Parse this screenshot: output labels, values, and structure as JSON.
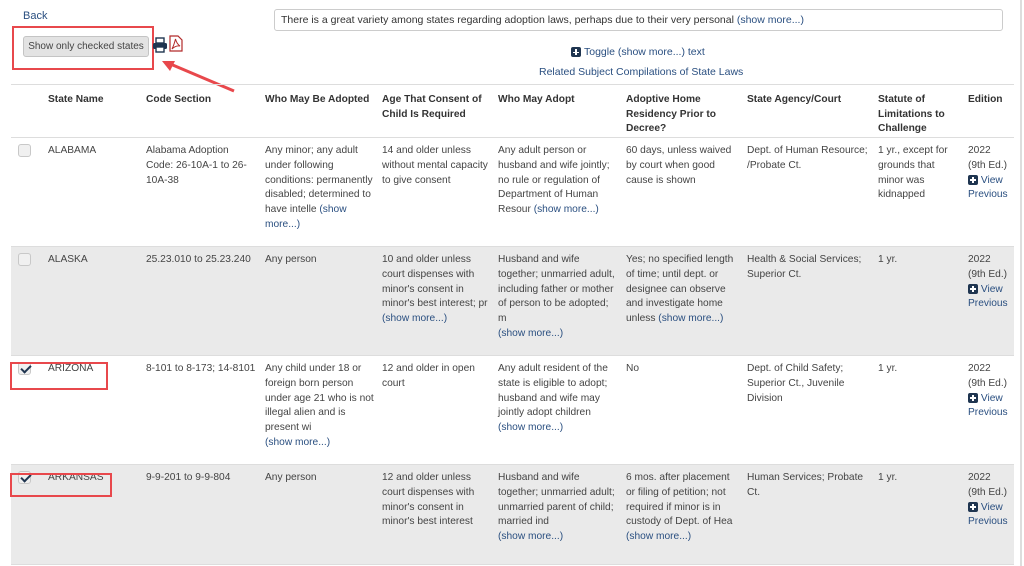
{
  "nav": {
    "back_label": "Back"
  },
  "toolbar": {
    "show_checked_label": "Show only checked states",
    "print_icon": "print-icon",
    "pdf_icon": "pdf-icon"
  },
  "intro": {
    "text": "There is a great variety among states regarding adoption laws, perhaps due to their very personal",
    "show_more": "(show more...)"
  },
  "toggle_label": "Toggle (show more...) text",
  "related_label": "Related Subject Compilations of State Laws",
  "colors": {
    "accent": "#2a4f80",
    "callout": "#e8484c",
    "row_shade": "#eaeaea"
  },
  "table": {
    "headers": [
      "",
      "State Name",
      "Code Section",
      "Who May Be Adopted",
      "Age That Consent of Child Is Required",
      "Who May Adopt",
      "Adoptive Home Residency Prior to Decree?",
      "State Agency/Court",
      "Statute of Limitations to Challenge",
      "Edition"
    ],
    "show_more": "(show more...)",
    "rows": [
      {
        "checked": false,
        "state": "ALABAMA",
        "code": "Alabama Adoption Code: 26-10A-1 to 26-10A-38",
        "who_adopted": "Any minor; any adult under following conditions: permanently disabled; determined to have intelle",
        "who_adopted_more": true,
        "age_consent": "14 and older unless without mental capacity to give consent",
        "age_consent_more": false,
        "who_adopt": "Any adult person or husband and wife jointly; no rule or regulation of Department of Human Resour",
        "who_adopt_more": true,
        "residency": "60 days, unless waived by court when good cause is shown",
        "residency_more": false,
        "agency": "Dept. of Human Resource; /Probate Ct.",
        "limitations": "1 yr., except for grounds that minor was kidnapped",
        "edition": "2022 (9th Ed.)",
        "view_previous": "View Previous"
      },
      {
        "checked": false,
        "state": "ALASKA",
        "code": "25.23.010 to 25.23.240",
        "who_adopted": "Any person",
        "who_adopted_more": false,
        "age_consent": "10 and older unless court dispenses with minor's consent in minor's best interest; pr",
        "age_consent_more": true,
        "who_adopt": "Husband and wife together; unmarried adult, including father or mother of person to be adopted; m",
        "who_adopt_more": true,
        "residency": "Yes; no specified length of time; until dept. or designee can observe and investigate home unless",
        "residency_more": true,
        "agency": "Health & Social Services; Superior Ct.",
        "limitations": "1 yr.",
        "edition": "2022 (9th Ed.)",
        "view_previous": "View Previous"
      },
      {
        "checked": true,
        "state": "ARIZONA",
        "code": "8-101 to 8-173; 14-8101",
        "who_adopted": "Any child under 18 or foreign born person under age 21 who is not illegal alien and is present wi",
        "who_adopted_more": true,
        "age_consent": "12 and older in open court",
        "age_consent_more": false,
        "who_adopt": "Any adult resident of the state is eligible to adopt; husband and wife may jointly adopt children",
        "who_adopt_more": true,
        "residency": "No",
        "residency_more": false,
        "agency": "Dept. of Child Safety; Superior Ct., Juvenile Division",
        "limitations": "1 yr.",
        "edition": "2022 (9th Ed.)",
        "view_previous": "View Previous"
      },
      {
        "checked": true,
        "state": "ARKANSAS",
        "code": "9-9-201 to 9-9-804",
        "who_adopted": "Any person",
        "who_adopted_more": false,
        "age_consent": "12 and older unless court dispenses with minor's consent in minor's best interest",
        "age_consent_more": false,
        "who_adopt": "Husband and wife together; unmarried adult; unmarried parent of child; married ind",
        "who_adopt_more": true,
        "residency": "6 mos. after placement or filing of petition; not required if minor is in custody of Dept. of Hea",
        "residency_more": true,
        "agency": "Human Services; Probate Ct.",
        "limitations": "1 yr.",
        "edition": "2022 (9th Ed.)",
        "view_previous": "View Previous"
      }
    ]
  }
}
